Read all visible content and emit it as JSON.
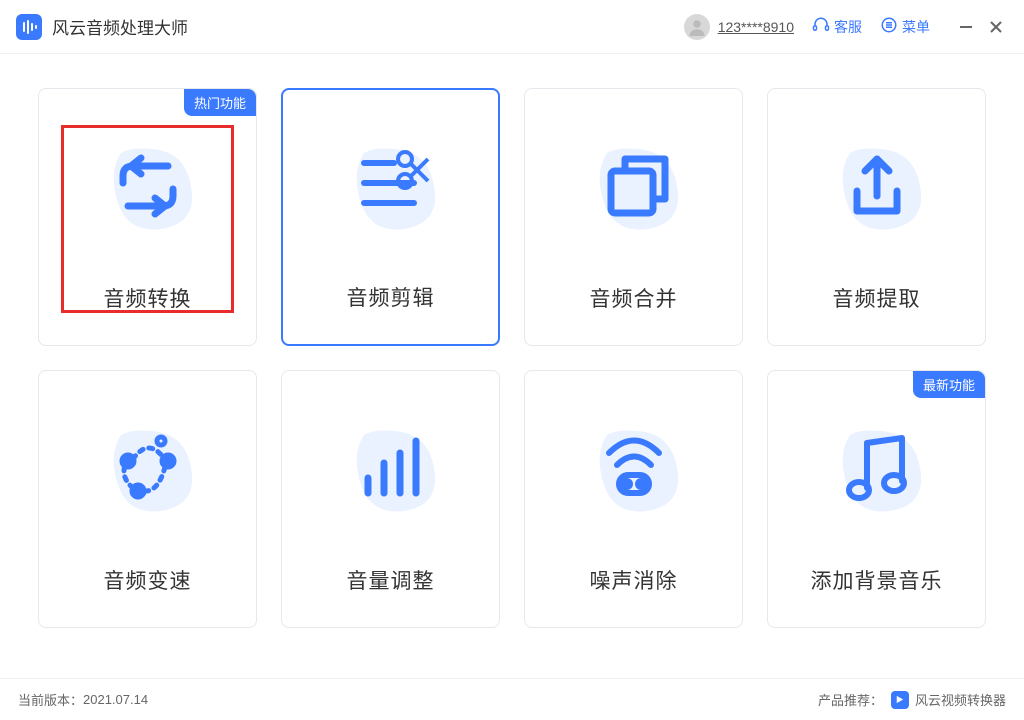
{
  "app": {
    "title": "风云音频处理大师"
  },
  "header": {
    "user_id": "123****8910",
    "support_label": "客服",
    "menu_label": "菜单"
  },
  "colors": {
    "accent": "#3a7afe",
    "highlight_border": "#e82c2c"
  },
  "cards": [
    {
      "label": "音频转换",
      "badge": "热门功能",
      "highlighted": true,
      "selected": false,
      "icon": "convert"
    },
    {
      "label": "音频剪辑",
      "badge": null,
      "highlighted": false,
      "selected": true,
      "icon": "cut"
    },
    {
      "label": "音频合并",
      "badge": null,
      "highlighted": false,
      "selected": false,
      "icon": "merge"
    },
    {
      "label": "音频提取",
      "badge": null,
      "highlighted": false,
      "selected": false,
      "icon": "extract"
    },
    {
      "label": "音频变速",
      "badge": null,
      "highlighted": false,
      "selected": false,
      "icon": "speed"
    },
    {
      "label": "音量调整",
      "badge": null,
      "highlighted": false,
      "selected": false,
      "icon": "volume"
    },
    {
      "label": "噪声消除",
      "badge": null,
      "highlighted": false,
      "selected": false,
      "icon": "denoise"
    },
    {
      "label": "添加背景音乐",
      "badge": "最新功能",
      "highlighted": false,
      "selected": false,
      "icon": "bgm"
    }
  ],
  "footer": {
    "version_label": "当前版本：",
    "version": "2021.07.14",
    "recommend_label": "产品推荐：",
    "recommend_product": "风云视频转换器"
  }
}
